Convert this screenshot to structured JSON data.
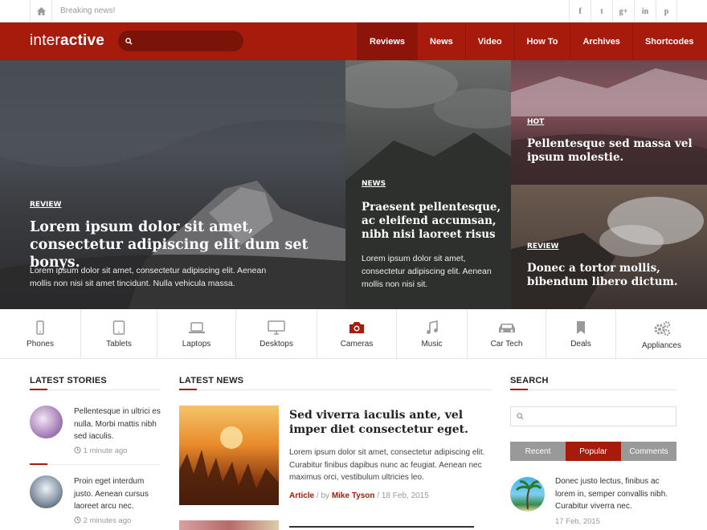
{
  "topbar": {
    "breaking": "Breaking news!",
    "social": [
      "f",
      "t",
      "g+",
      "in",
      "p"
    ]
  },
  "nav": {
    "logo_light": "inter",
    "logo_bold": "active",
    "search_placeholder": "",
    "menu": [
      "Reviews",
      "News",
      "Video",
      "How To",
      "Archives",
      "Shortcodes"
    ],
    "active": "Reviews"
  },
  "hero": [
    {
      "tag": "REVIEW",
      "title": "Lorem ipsum dolor sit amet, consectetur adipiscing elit dum set bonys.",
      "excerpt": "Lorem ipsum dolor sit amet, consectetur adipiscing elit. Aenean mollis non nisi sit amet tincidunt. Nulla vehicula massa."
    },
    {
      "tag": "NEWS",
      "title": "Praesent pellentesque, ac eleifend accumsan, nibh nisi laoreet risus",
      "excerpt": "Lorem ipsum dolor sit amet, consectetur adipiscing elit. Aenean mollis non nisi sit."
    },
    {
      "tag": "HOT",
      "title": "Pellentesque sed massa vel ipsum molestie."
    },
    {
      "tag": "REVIEW",
      "title": "Donec a tortor mollis, bibendum libero dictum."
    }
  ],
  "categories": [
    {
      "label": "Phones",
      "icon": "phone-icon"
    },
    {
      "label": "Tablets",
      "icon": "tablet-icon"
    },
    {
      "label": "Laptops",
      "icon": "laptop-icon"
    },
    {
      "label": "Desktops",
      "icon": "desktop-icon"
    },
    {
      "label": "Cameras",
      "icon": "camera-icon"
    },
    {
      "label": "Music",
      "icon": "music-icon"
    },
    {
      "label": "Car Tech",
      "icon": "car-icon"
    },
    {
      "label": "Deals",
      "icon": "bookmark-icon"
    },
    {
      "label": "Appliances",
      "icon": "gears-icon"
    }
  ],
  "latest_stories": {
    "title": "LATEST STORIES",
    "items": [
      {
        "text": "Pellentesque in ultrici es nulla. Morbi mattis nibh sed iaculis.",
        "time": "1 minute ago"
      },
      {
        "text": "Proin eget interdum justo. Aenean cursus laoreet arcu nec.",
        "time": "2 minutes ago"
      }
    ]
  },
  "latest_news": {
    "title": "LATEST NEWS",
    "item": {
      "title": "Sed viverra iaculis ante, vel imper diet consectetur eget.",
      "excerpt": "Lorem ipsum dolor sit amet, consectetur adipiscing elit. Curabitur finibus dapibus nunc ac feugiat. Aenean nec maximus orci, vestibulum ultricies leo.",
      "category": "Article",
      "by": "by",
      "author": "Mike Tyson",
      "date": "18 Feb, 2015"
    }
  },
  "sidebar": {
    "search_title": "SEARCH",
    "tabs": [
      "Recent",
      "Popular",
      "Comments"
    ],
    "active_tab": "Popular",
    "popular": {
      "text": "Donec justo lectus, finibus ac lorem in, semper convallis nibh. Curabitur viverra nec.",
      "date": "17 Feb, 2015"
    }
  },
  "colors": {
    "accent": "#a71b0c"
  }
}
